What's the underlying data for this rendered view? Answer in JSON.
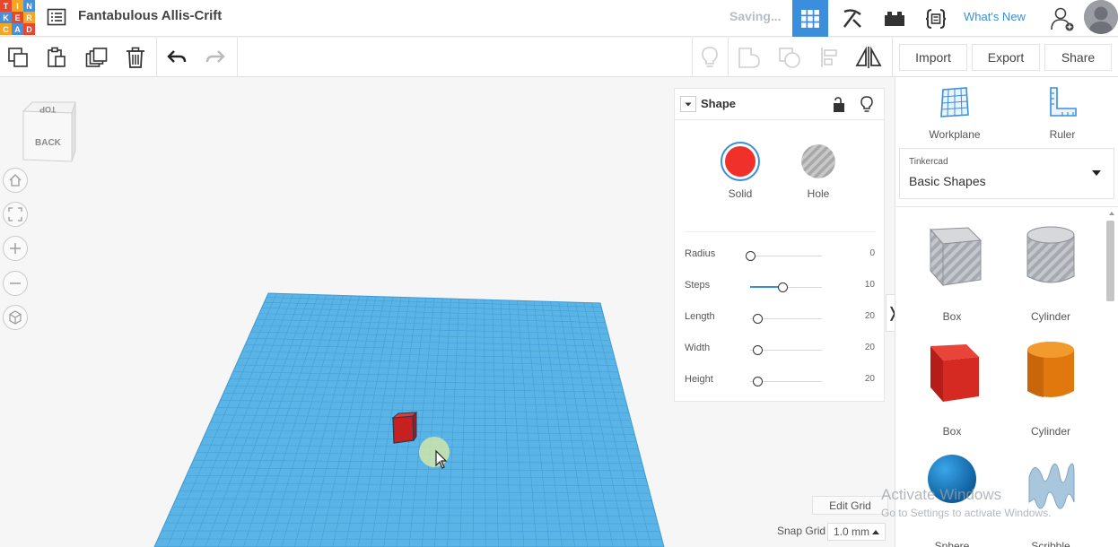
{
  "app": {
    "logo_letters": [
      "T",
      "I",
      "N",
      "K",
      "E",
      "R",
      "C",
      "A",
      "D"
    ],
    "logo_colors": [
      "#e8472f",
      "#f5a623",
      "#4a90d9",
      "#4a90d9",
      "#e8472f",
      "#f5a623",
      "#f5a623",
      "#4a90d9",
      "#e8472f"
    ],
    "document_title": "Fantabulous Allis-Crift",
    "status": "Saving...",
    "whats_new": "What's New",
    "accent_color": "#3a8edb"
  },
  "toolbar": {
    "import_label": "Import",
    "export_label": "Export",
    "share_label": "Share",
    "tools_left": [
      "copy-icon",
      "paste-icon",
      "duplicate-icon",
      "trash-icon",
      "undo-icon",
      "redo-icon"
    ],
    "tools_right": [
      "lightbulb-icon",
      "group-icon",
      "ungroup-icon",
      "align-icon",
      "mirror-icon"
    ]
  },
  "viewcube": {
    "top_label": "TOP",
    "front_label": "BACK"
  },
  "shape_panel": {
    "title": "Shape",
    "solid_label": "Solid",
    "hole_label": "Hole",
    "solid_color": "#f0302a",
    "params": [
      {
        "label": "Radius",
        "value": "0",
        "fraction": 0.0
      },
      {
        "label": "Steps",
        "value": "10",
        "fraction": 0.45
      },
      {
        "label": "Length",
        "value": "20",
        "fraction": 0.1
      },
      {
        "label": "Width",
        "value": "20",
        "fraction": 0.1
      },
      {
        "label": "Height",
        "value": "20",
        "fraction": 0.1
      }
    ]
  },
  "right_panel": {
    "workplane_label": "Workplane",
    "ruler_label": "Ruler",
    "library_category": "Tinkercad",
    "library_name": "Basic Shapes",
    "shapes": [
      {
        "label": "Box",
        "kind": "box-hole"
      },
      {
        "label": "Cylinder",
        "kind": "cylinder-hole"
      },
      {
        "label": "Box",
        "kind": "box-solid"
      },
      {
        "label": "Cylinder",
        "kind": "cylinder-solid"
      },
      {
        "label": "Sphere",
        "kind": "sphere"
      },
      {
        "label": "Scribble",
        "kind": "scribble"
      }
    ]
  },
  "grid": {
    "edit_grid_label": "Edit Grid",
    "snap_grid_label": "Snap Grid",
    "snap_grid_value": "1.0 mm"
  },
  "watermark": {
    "line1": "Activate Windows",
    "line2": "Go to Settings to activate Windows."
  }
}
